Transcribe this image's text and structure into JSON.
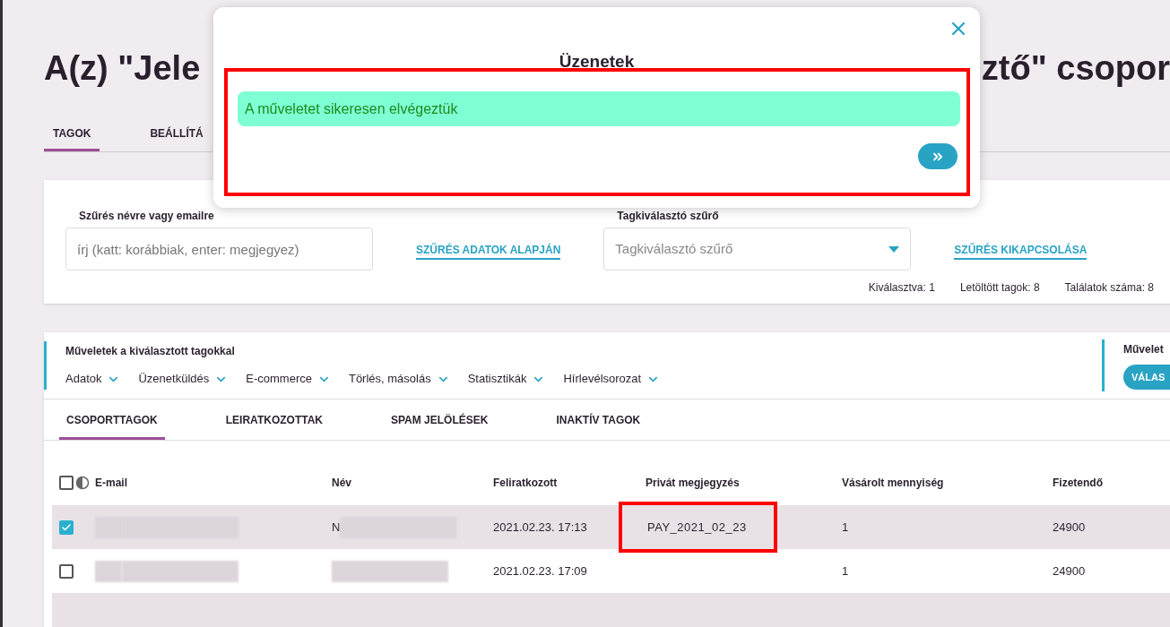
{
  "page_title_fragments": [
    "A(z) \"Jele",
    "ztő\" csopor"
  ],
  "tabs": [
    {
      "label": "TAGOK",
      "selected": true
    },
    {
      "label": "BEÁLLÍTÁ",
      "selected": false
    }
  ],
  "filter": {
    "name_label": "Szűrés névre vagy emailre",
    "name_placeholder": "írj (katt: korábbiak, enter: megjegyez)",
    "data_filter_link": "SZŰRÉS ADATOK ALAPJÁN",
    "selector_label": "Tagkiválasztó szűrő",
    "selector_placeholder": "Tagkiválasztó szűrő",
    "disable_link": "SZŰRÉS KIKAPCSOLÁSA",
    "counts": [
      "Kiválasztva: 1",
      "Letöltött tagok: 8",
      "Találatok száma: 8"
    ]
  },
  "actions": {
    "title": "Műveletek a kiválasztott tagokkal",
    "menus": [
      "Adatok",
      "Üzenetküldés",
      "E-commerce",
      "Törlés, másolás",
      "Statisztikák",
      "Hírlevélsorozat"
    ],
    "side_title": "Művelet",
    "side_button": "VÁLAS"
  },
  "member_tabs": [
    {
      "label": "CSOPORTTAGOK",
      "selected": true
    },
    {
      "label": "LEIRATKOZOTTAK",
      "selected": false
    },
    {
      "label": "SPAM JELÖLÉSEK",
      "selected": false
    },
    {
      "label": "INAKTÍV TAGOK",
      "selected": false
    }
  ],
  "table": {
    "all_checked": false,
    "columns": [
      "E-mail",
      "Név",
      "Feliratkozott",
      "Privát megjegyzés",
      "Vásárolt mennyiség",
      "Fizetendő"
    ],
    "rows": [
      {
        "checked": true,
        "name": "N",
        "subscribed": "2021.02.23. 17:13",
        "note": "PAY_2021_02_23",
        "quantity": "1",
        "payable": "24900",
        "highlighted": true
      },
      {
        "checked": false,
        "name": "",
        "subscribed": "2021.02.23. 17:09",
        "note": "",
        "quantity": "1",
        "payable": "24900",
        "highlighted": false
      }
    ]
  },
  "modal": {
    "title": "Üzenetek",
    "message": "A műveletet sikeresen elvégeztük"
  }
}
